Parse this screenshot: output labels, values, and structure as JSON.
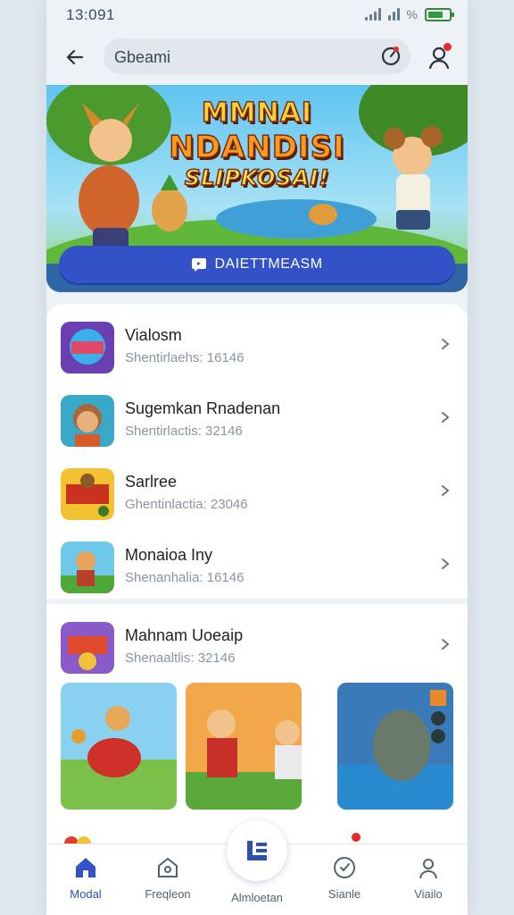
{
  "status": {
    "time": "13:091",
    "percent": "%"
  },
  "search": {
    "value": "Gbeami"
  },
  "banner": {
    "title_line1": "MMNAI",
    "title_line2": "NDANDISI",
    "title_line3": "SLIPKOSAI!",
    "cta_label": "DAIETTMEASM"
  },
  "list": [
    {
      "title": "Vialosm",
      "subtitle": "Shentirlaehs: 16146"
    },
    {
      "title": "Sugemkan Rnadenan",
      "subtitle": "Shentirlactis: 32146"
    },
    {
      "title": "Sarlree",
      "subtitle": "Ghentinlactia: 23046"
    },
    {
      "title": "Monaioa Iny",
      "subtitle": "Shenanhalia: 16146"
    },
    {
      "title": "Mahnam Uoeaip",
      "subtitle": "Shenaaltlis: 32146"
    }
  ],
  "nav": [
    {
      "label": "Modal"
    },
    {
      "label": "Freqleon"
    },
    {
      "label": "Almloetan"
    },
    {
      "label": "Sianle"
    },
    {
      "label": "Viailo"
    }
  ],
  "colors": {
    "accent": "#3352c8",
    "badge": "#e32b2b",
    "battery": "#2f9a3e"
  }
}
